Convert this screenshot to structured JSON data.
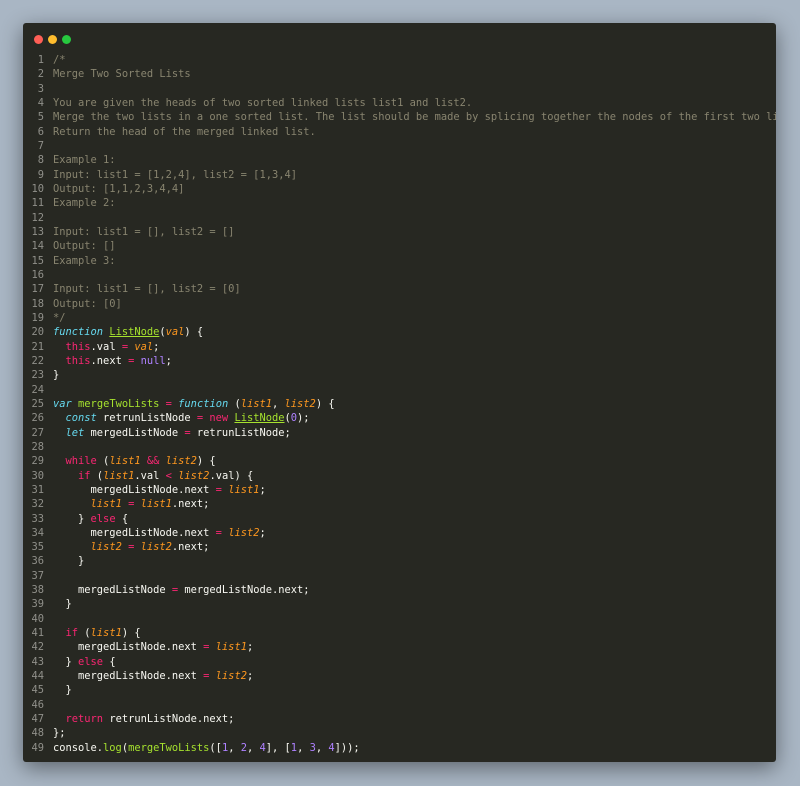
{
  "window": {
    "buttons": [
      "close",
      "minimize",
      "maximize"
    ],
    "colors": {
      "background": "#272822",
      "comment": "#88846f",
      "keyword": "#f92672",
      "storage": "#66d9ef",
      "function": "#a6e22e",
      "param": "#fd971f",
      "number": "#ae81ff",
      "text": "#f8f8f2"
    }
  },
  "code": {
    "language": "javascript",
    "lines": [
      [
        [
          "com",
          "/*"
        ]
      ],
      [
        [
          "com",
          "Merge Two Sorted Lists"
        ]
      ],
      [],
      [
        [
          "com",
          "You are given the heads of two sorted linked lists list1 and list2."
        ]
      ],
      [
        [
          "com",
          "Merge the two lists in a one sorted list. The list should be made by splicing together the nodes of the first two lists."
        ]
      ],
      [
        [
          "com",
          "Return the head of the merged linked list."
        ]
      ],
      [],
      [
        [
          "com",
          "Example 1:"
        ]
      ],
      [
        [
          "com",
          "Input: list1 = [1,2,4], list2 = [1,3,4]"
        ]
      ],
      [
        [
          "com",
          "Output: [1,1,2,3,4,4]"
        ]
      ],
      [
        [
          "com",
          "Example 2:"
        ]
      ],
      [],
      [
        [
          "com",
          "Input: list1 = [], list2 = []"
        ]
      ],
      [
        [
          "com",
          "Output: []"
        ]
      ],
      [
        [
          "com",
          "Example 3:"
        ]
      ],
      [],
      [
        [
          "com",
          "Input: list1 = [], list2 = [0]"
        ]
      ],
      [
        [
          "com",
          "Output: [0]"
        ]
      ],
      [
        [
          "com",
          "*/"
        ]
      ],
      [
        [
          "sk",
          "function"
        ],
        [
          "pl",
          " "
        ],
        [
          "fnu",
          "ListNode"
        ],
        [
          "pl",
          "("
        ],
        [
          "par",
          "val"
        ],
        [
          "pl",
          ") {"
        ]
      ],
      [
        [
          "pl",
          "  "
        ],
        [
          "kw",
          "this"
        ],
        [
          "pl",
          ".val "
        ],
        [
          "op",
          "="
        ],
        [
          "pl",
          " "
        ],
        [
          "par",
          "val"
        ],
        [
          "pl",
          ";"
        ]
      ],
      [
        [
          "pl",
          "  "
        ],
        [
          "kw",
          "this"
        ],
        [
          "pl",
          ".next "
        ],
        [
          "op",
          "="
        ],
        [
          "pl",
          " "
        ],
        [
          "num",
          "null"
        ],
        [
          "pl",
          ";"
        ]
      ],
      [
        [
          "pl",
          "}"
        ]
      ],
      [],
      [
        [
          "sk",
          "var"
        ],
        [
          "pl",
          " "
        ],
        [
          "fn",
          "mergeTwoLists"
        ],
        [
          "pl",
          " "
        ],
        [
          "op",
          "="
        ],
        [
          "pl",
          " "
        ],
        [
          "sk",
          "function"
        ],
        [
          "pl",
          " ("
        ],
        [
          "par",
          "list1"
        ],
        [
          "pl",
          ", "
        ],
        [
          "par",
          "list2"
        ],
        [
          "pl",
          ") {"
        ]
      ],
      [
        [
          "pl",
          "  "
        ],
        [
          "sk",
          "const"
        ],
        [
          "pl",
          " retrunListNode "
        ],
        [
          "op",
          "="
        ],
        [
          "pl",
          " "
        ],
        [
          "kw",
          "new"
        ],
        [
          "pl",
          " "
        ],
        [
          "fnu",
          "ListNode"
        ],
        [
          "pl",
          "("
        ],
        [
          "num",
          "0"
        ],
        [
          "pl",
          ");"
        ]
      ],
      [
        [
          "pl",
          "  "
        ],
        [
          "sk",
          "let"
        ],
        [
          "pl",
          " mergedListNode "
        ],
        [
          "op",
          "="
        ],
        [
          "pl",
          " retrunListNode;"
        ]
      ],
      [],
      [
        [
          "pl",
          "  "
        ],
        [
          "kw",
          "while"
        ],
        [
          "pl",
          " ("
        ],
        [
          "par",
          "list1"
        ],
        [
          "pl",
          " "
        ],
        [
          "op",
          "&&"
        ],
        [
          "pl",
          " "
        ],
        [
          "par",
          "list2"
        ],
        [
          "pl",
          ") {"
        ]
      ],
      [
        [
          "pl",
          "    "
        ],
        [
          "kw",
          "if"
        ],
        [
          "pl",
          " ("
        ],
        [
          "par",
          "list1"
        ],
        [
          "pl",
          ".val "
        ],
        [
          "op",
          "<"
        ],
        [
          "pl",
          " "
        ],
        [
          "par",
          "list2"
        ],
        [
          "pl",
          ".val) {"
        ]
      ],
      [
        [
          "pl",
          "      mergedListNode.next "
        ],
        [
          "op",
          "="
        ],
        [
          "pl",
          " "
        ],
        [
          "par",
          "list1"
        ],
        [
          "pl",
          ";"
        ]
      ],
      [
        [
          "pl",
          "      "
        ],
        [
          "par",
          "list1"
        ],
        [
          "pl",
          " "
        ],
        [
          "op",
          "="
        ],
        [
          "pl",
          " "
        ],
        [
          "par",
          "list1"
        ],
        [
          "pl",
          ".next;"
        ]
      ],
      [
        [
          "pl",
          "    } "
        ],
        [
          "kw",
          "else"
        ],
        [
          "pl",
          " {"
        ]
      ],
      [
        [
          "pl",
          "      mergedListNode.next "
        ],
        [
          "op",
          "="
        ],
        [
          "pl",
          " "
        ],
        [
          "par",
          "list2"
        ],
        [
          "pl",
          ";"
        ]
      ],
      [
        [
          "pl",
          "      "
        ],
        [
          "par",
          "list2"
        ],
        [
          "pl",
          " "
        ],
        [
          "op",
          "="
        ],
        [
          "pl",
          " "
        ],
        [
          "par",
          "list2"
        ],
        [
          "pl",
          ".next;"
        ]
      ],
      [
        [
          "pl",
          "    }"
        ]
      ],
      [],
      [
        [
          "pl",
          "    mergedListNode "
        ],
        [
          "op",
          "="
        ],
        [
          "pl",
          " mergedListNode.next;"
        ]
      ],
      [
        [
          "pl",
          "  }"
        ]
      ],
      [],
      [
        [
          "pl",
          "  "
        ],
        [
          "kw",
          "if"
        ],
        [
          "pl",
          " ("
        ],
        [
          "par",
          "list1"
        ],
        [
          "pl",
          ") {"
        ]
      ],
      [
        [
          "pl",
          "    mergedListNode.next "
        ],
        [
          "op",
          "="
        ],
        [
          "pl",
          " "
        ],
        [
          "par",
          "list1"
        ],
        [
          "pl",
          ";"
        ]
      ],
      [
        [
          "pl",
          "  } "
        ],
        [
          "kw",
          "else"
        ],
        [
          "pl",
          " {"
        ]
      ],
      [
        [
          "pl",
          "    mergedListNode.next "
        ],
        [
          "op",
          "="
        ],
        [
          "pl",
          " "
        ],
        [
          "par",
          "list2"
        ],
        [
          "pl",
          ";"
        ]
      ],
      [
        [
          "pl",
          "  }"
        ]
      ],
      [],
      [
        [
          "pl",
          "  "
        ],
        [
          "kw",
          "return"
        ],
        [
          "pl",
          " retrunListNode.next;"
        ]
      ],
      [
        [
          "pl",
          "};"
        ]
      ],
      [
        [
          "pl",
          "console."
        ],
        [
          "fn",
          "log"
        ],
        [
          "pl",
          "("
        ],
        [
          "fn",
          "mergeTwoLists"
        ],
        [
          "pl",
          "(["
        ],
        [
          "num",
          "1"
        ],
        [
          "pl",
          ", "
        ],
        [
          "num",
          "2"
        ],
        [
          "pl",
          ", "
        ],
        [
          "num",
          "4"
        ],
        [
          "pl",
          "], ["
        ],
        [
          "num",
          "1"
        ],
        [
          "pl",
          ", "
        ],
        [
          "num",
          "3"
        ],
        [
          "pl",
          ", "
        ],
        [
          "num",
          "4"
        ],
        [
          "pl",
          "]));"
        ]
      ]
    ]
  }
}
